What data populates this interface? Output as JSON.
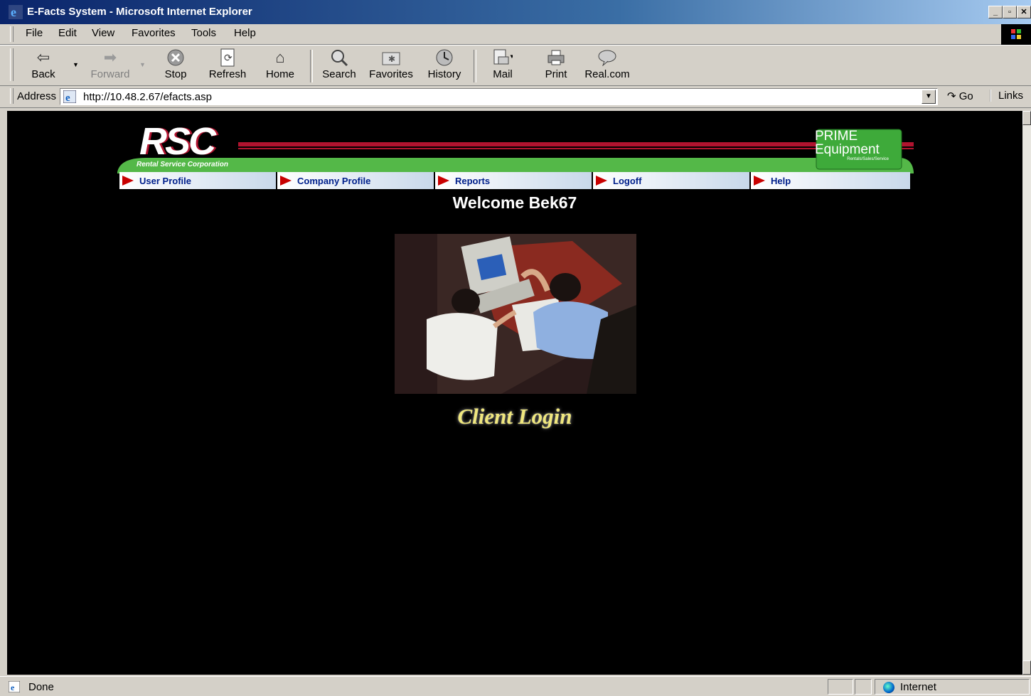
{
  "window": {
    "title": "E-Facts System - Microsoft Internet Explorer"
  },
  "menu": [
    "File",
    "Edit",
    "View",
    "Favorites",
    "Tools",
    "Help"
  ],
  "toolbar": {
    "back": "Back",
    "forward": "Forward",
    "stop": "Stop",
    "refresh": "Refresh",
    "home": "Home",
    "search": "Search",
    "favorites": "Favorites",
    "history": "History",
    "mail": "Mail",
    "print": "Print",
    "real": "Real.com"
  },
  "address": {
    "label": "Address",
    "url": "http://10.48.2.67/efacts.asp",
    "go": "Go",
    "links": "Links"
  },
  "site": {
    "logo_text": "RSC",
    "logo_tagline": "Rental Service Corporation",
    "prime_line1": "PRIME",
    "prime_line2": "Equipment",
    "prime_tagline": "Rentals/Sales/Service",
    "nav": [
      "User Profile",
      "Company Profile",
      "Reports",
      "Logoff",
      "Help"
    ],
    "welcome": "Welcome Bek67",
    "client_login": "Client Login"
  },
  "status": {
    "text": "Done",
    "zone": "Internet"
  },
  "colors": {
    "title_bar": "#0a246a",
    "nav_text": "#00208c",
    "nav_arrow": "#c80000",
    "banner_green": "#54b848",
    "banner_red": "#b0132f",
    "login_yellow": "#f0e77e"
  }
}
